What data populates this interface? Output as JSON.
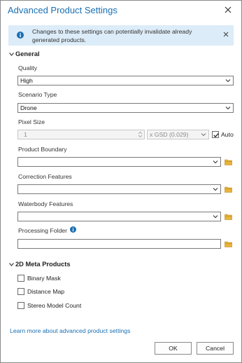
{
  "dialog": {
    "title": "Advanced Product Settings"
  },
  "banner": {
    "message": "Changes to these settings can potentially invalidate already generated products."
  },
  "general": {
    "header": "General",
    "quality_label": "Quality",
    "quality_value": "High",
    "scenario_label": "Scenario Type",
    "scenario_value": "Drone",
    "pixel_size_label": "Pixel Size",
    "pixel_size_value": "1",
    "gsd_value": "x GSD (0.029)",
    "auto_label": "Auto",
    "auto_checked": true,
    "product_boundary_label": "Product Boundary",
    "correction_features_label": "Correction Features",
    "waterbody_features_label": "Waterbody Features",
    "processing_folder_label": "Processing Folder"
  },
  "meta_products": {
    "header": "2D Meta Products",
    "items": [
      {
        "label": "Binary Mask",
        "checked": false
      },
      {
        "label": "Distance Map",
        "checked": false
      },
      {
        "label": "Stereo Model Count",
        "checked": false
      }
    ]
  },
  "footer": {
    "link": "Learn more about advanced product settings",
    "ok_label": "OK",
    "cancel_label": "Cancel"
  },
  "colors": {
    "accent": "#1a6fb3",
    "banner_bg": "#dcecf8",
    "folder": "#e8b339"
  }
}
